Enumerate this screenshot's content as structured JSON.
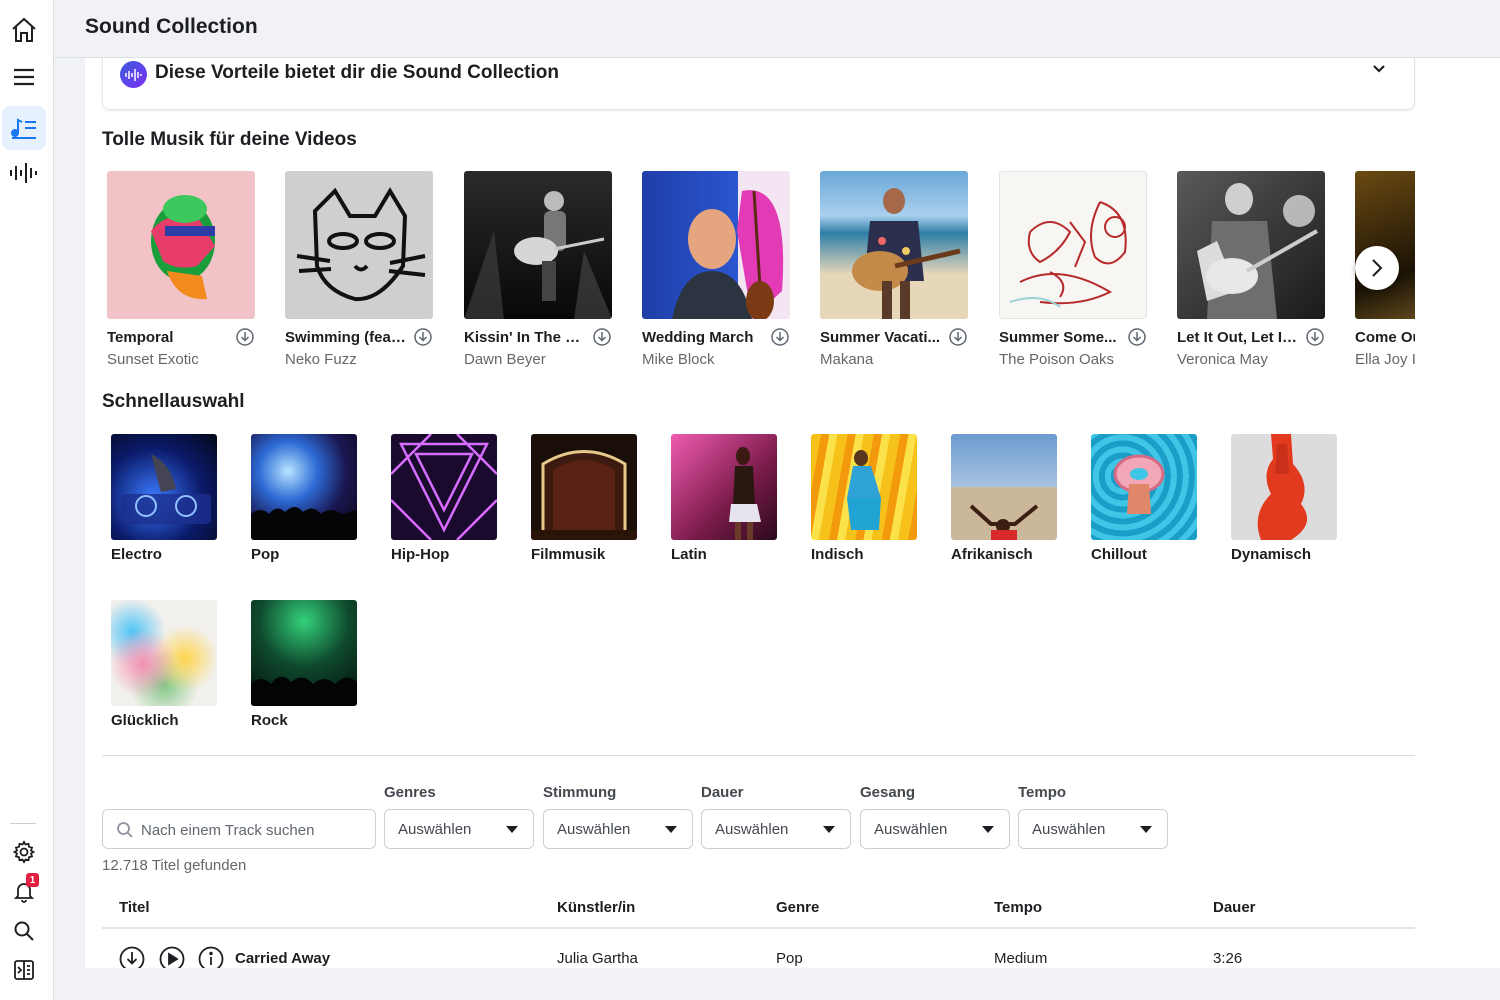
{
  "app": {
    "title": "Sound Collection"
  },
  "rail": {
    "notification_count": "1"
  },
  "benefits": {
    "title": "Diese Vorteile bietet dir die Sound Collection"
  },
  "featured": {
    "title": "Tolle Musik für deine Videos",
    "tracks": [
      {
        "title": "Temporal",
        "artist": "Sunset Exotic"
      },
      {
        "title": "Swimming (feat...",
        "artist": "Neko Fuzz"
      },
      {
        "title": "Kissin' In The Ki...",
        "artist": "Dawn Beyer"
      },
      {
        "title": "Wedding March",
        "artist": "Mike Block"
      },
      {
        "title": "Summer Vacati...",
        "artist": "Makana"
      },
      {
        "title": "Summer Some...",
        "artist": "The Poison Oaks"
      },
      {
        "title": "Let It Out, Let It...",
        "artist": "Veronica May"
      },
      {
        "title": "Come Ou",
        "artist": "Ella Joy I"
      }
    ]
  },
  "quick_pick": {
    "title": "Schnellauswahl",
    "genres": [
      "Electro",
      "Pop",
      "Hip-Hop",
      "Filmmusik",
      "Latin",
      "Indisch",
      "Afrikanisch",
      "Chillout",
      "Dynamisch",
      "Glücklich",
      "Rock"
    ]
  },
  "filters": {
    "search_placeholder": "Nach einem Track suchen",
    "selects": [
      {
        "label": "Genres",
        "value": "Auswählen"
      },
      {
        "label": "Stimmung",
        "value": "Auswählen"
      },
      {
        "label": "Dauer",
        "value": "Auswählen"
      },
      {
        "label": "Gesang",
        "value": "Auswählen"
      },
      {
        "label": "Tempo",
        "value": "Auswählen"
      }
    ],
    "results_count": "12.718 Titel gefunden"
  },
  "table": {
    "columns": [
      "Titel",
      "Künstler/in",
      "Genre",
      "Tempo",
      "Dauer"
    ],
    "rows": [
      {
        "title": "Carried Away",
        "artist": "Julia Gartha",
        "genre": "Pop",
        "tempo": "Medium",
        "duration": "3:26"
      }
    ]
  }
}
